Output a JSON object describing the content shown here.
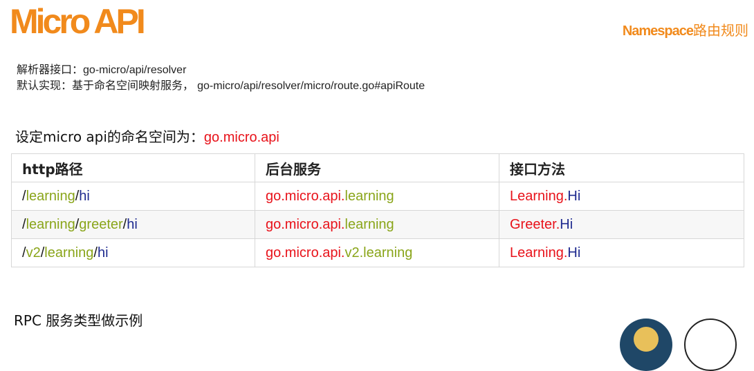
{
  "header": {
    "logo": "Micro API",
    "topic_en": "Namespace",
    "topic_zh": "路由规则"
  },
  "description": {
    "line1_label": "解析器接口：",
    "line1_value": "go-micro/api/resolver",
    "line2_label": "默认实现：基于命名空间映射服务，",
    "line2_value": "go-micro/api/resolver/micro/route.go#apiRoute"
  },
  "namespace": {
    "label": "设定micro api的命名空间为：",
    "value": "go.micro.api"
  },
  "table": {
    "headers": [
      "http路径",
      "后台服务",
      "接口方法"
    ],
    "rows": [
      {
        "path": [
          [
            "/",
            "plain"
          ],
          [
            "learning",
            "green"
          ],
          [
            "/",
            "plain"
          ],
          [
            "hi",
            "navy"
          ]
        ],
        "service": [
          [
            "go.micro.api.",
            "red"
          ],
          [
            "learning",
            "green"
          ]
        ],
        "method": [
          [
            "Learning.",
            "red"
          ],
          [
            "Hi",
            "navy"
          ]
        ]
      },
      {
        "path": [
          [
            "/",
            "plain"
          ],
          [
            "learning",
            "green"
          ],
          [
            "/",
            "plain"
          ],
          [
            "greeter",
            "green"
          ],
          [
            "/",
            "plain"
          ],
          [
            "hi",
            "navy"
          ]
        ],
        "service": [
          [
            "go.micro.api.",
            "red"
          ],
          [
            "learning",
            "green"
          ]
        ],
        "method": [
          [
            "Greeter.",
            "red"
          ],
          [
            "Hi",
            "navy"
          ]
        ]
      },
      {
        "path": [
          [
            "/",
            "plain"
          ],
          [
            "v2",
            "green"
          ],
          [
            "/",
            "plain"
          ],
          [
            "learning",
            "green"
          ],
          [
            "/",
            "plain"
          ],
          [
            "hi",
            "navy"
          ]
        ],
        "service": [
          [
            "go.micro.api.",
            "red"
          ],
          [
            "v2.learning",
            "green"
          ]
        ],
        "method": [
          [
            "Learning.",
            "red"
          ],
          [
            "Hi",
            "navy"
          ]
        ]
      }
    ]
  },
  "footer": {
    "rpc_text": "RPC 服务类型做示例"
  },
  "colors": {
    "accent": "#f18a1c",
    "red": "#e8121a",
    "green": "#8aa51a",
    "navy": "#1e2a8f"
  }
}
